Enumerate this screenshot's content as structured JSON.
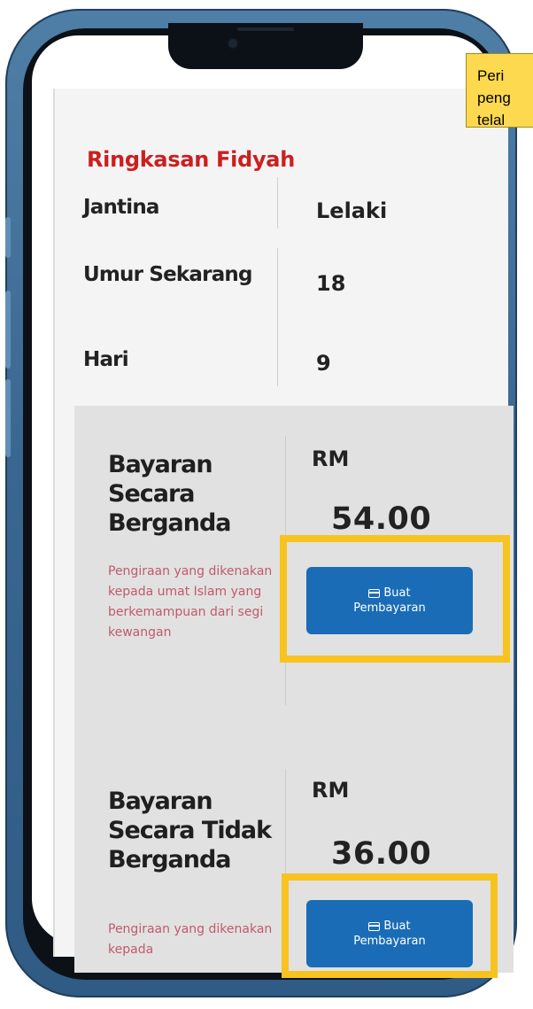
{
  "summary": {
    "title": "Ringkasan Fidyah",
    "rows": [
      {
        "label": "Jantina",
        "value": "Lelaki"
      },
      {
        "label": "Umur Sekarang",
        "value": "18"
      },
      {
        "label": "Hari",
        "value": "9"
      }
    ]
  },
  "payments": [
    {
      "title": "Bayaran Secara Berganda",
      "description": "Pengiraan yang dikenakan kepada umat Islam yang berkemampuan dari segi kewangan",
      "currency": "RM",
      "amount": "54.00",
      "button_label_line1": "Buat",
      "button_label_line2": "Pembayaran"
    },
    {
      "title": "Bayaran Secara Tidak Berganda",
      "description": "Pengiraan yang dikenakan kepada",
      "currency": "RM",
      "amount": "36.00",
      "button_label_line1": "Buat",
      "button_label_line2": "Pembayaran"
    }
  ],
  "hint": {
    "lines": [
      "Peri",
      "peng",
      "telal"
    ]
  },
  "colors": {
    "title_red": "#cc1f1f",
    "button_blue": "#1a6cb6",
    "highlight_yellow": "#f7c31f",
    "description_pink": "#c15a6c",
    "phone_frame": "#3a6790"
  }
}
